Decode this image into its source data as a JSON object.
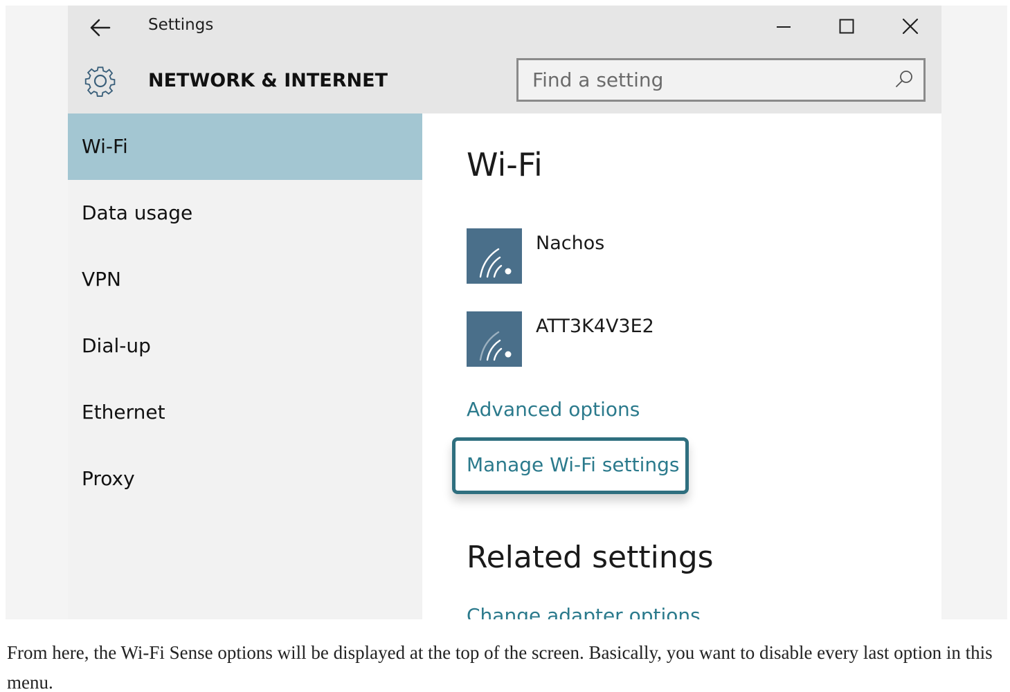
{
  "window": {
    "app_title": "Settings",
    "section_title": "NETWORK & INTERNET"
  },
  "search": {
    "placeholder": "Find a setting",
    "value": ""
  },
  "sidebar": {
    "selected": "Wi-Fi",
    "items": [
      {
        "label": "Wi-Fi"
      },
      {
        "label": "Data usage"
      },
      {
        "label": "VPN"
      },
      {
        "label": "Dial-up"
      },
      {
        "label": "Ethernet"
      },
      {
        "label": "Proxy"
      }
    ]
  },
  "main": {
    "heading": "Wi-Fi",
    "networks": [
      {
        "name": "Nachos"
      },
      {
        "name": "ATT3K4V3E2"
      }
    ],
    "advanced_link": "Advanced options",
    "manage_link": "Manage Wi-Fi settings",
    "related_heading": "Related settings",
    "adapter_link": "Change adapter options"
  },
  "caption": "From here, the Wi-Fi Sense options will be displayed at the top of the screen. Basically, you want to disable every last option in this menu.",
  "icons": {
    "back": "back-arrow-icon",
    "minimize": "minimize-icon",
    "maximize": "maximize-icon",
    "close": "close-icon",
    "gear": "gear-icon",
    "search": "search-icon",
    "wifi": "wifi-signal-icon"
  },
  "colors": {
    "titlebar": "#e6e6e6",
    "sidebar_bg": "#f2f2f2",
    "sidebar_selected": "#a3c6d2",
    "wifi_tile": "#4a6f8a",
    "link": "#2b7a8c",
    "highlight_border": "#2f6f7f"
  }
}
